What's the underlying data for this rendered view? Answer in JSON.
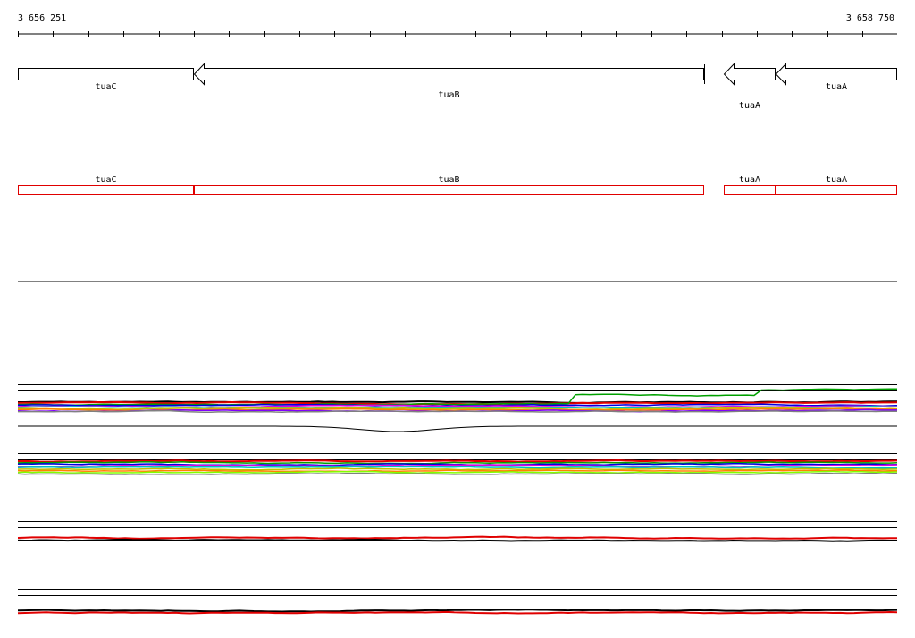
{
  "ruler": {
    "start_label": "3 656 251",
    "end_label": "3 658 750",
    "start": 3656251,
    "end": 3658750,
    "tick_step": 100
  },
  "genes": [
    {
      "name": "tuaC",
      "start": 3656251,
      "end": 3656752,
      "strand": "-"
    },
    {
      "name": "tuaB",
      "start": 3656752,
      "end": 3658202,
      "strand": "-"
    },
    {
      "name": "tuaA",
      "start": 3658258,
      "end": 3658405,
      "strand": "-"
    },
    {
      "name": "tuaA",
      "start": 3658405,
      "end": 3658750,
      "strand": "-"
    }
  ],
  "colors": {
    "gene_outline": "#000000",
    "feature_outline": "#e00000",
    "track_line": "#000000"
  },
  "tracks": [
    {
      "name": "expression-track-1",
      "colors": [
        "#000000",
        "#e00000",
        "#00a000",
        "#0000e0",
        "#e000e0",
        "#00c0c0",
        "#c0c000",
        "#ff8000",
        "#8000ff",
        "#808080"
      ]
    },
    {
      "name": "expression-track-2",
      "colors": [
        "#e00000",
        "#00a000",
        "#0000e0",
        "#e000e0",
        "#00c0c0",
        "#c0c000",
        "#ff8000",
        "#80ff00",
        "#808080"
      ]
    },
    {
      "name": "expression-track-3",
      "colors": [
        "#e00000",
        "#000000"
      ]
    },
    {
      "name": "expression-track-4",
      "colors": [
        "#000000",
        "#e00000"
      ]
    }
  ]
}
